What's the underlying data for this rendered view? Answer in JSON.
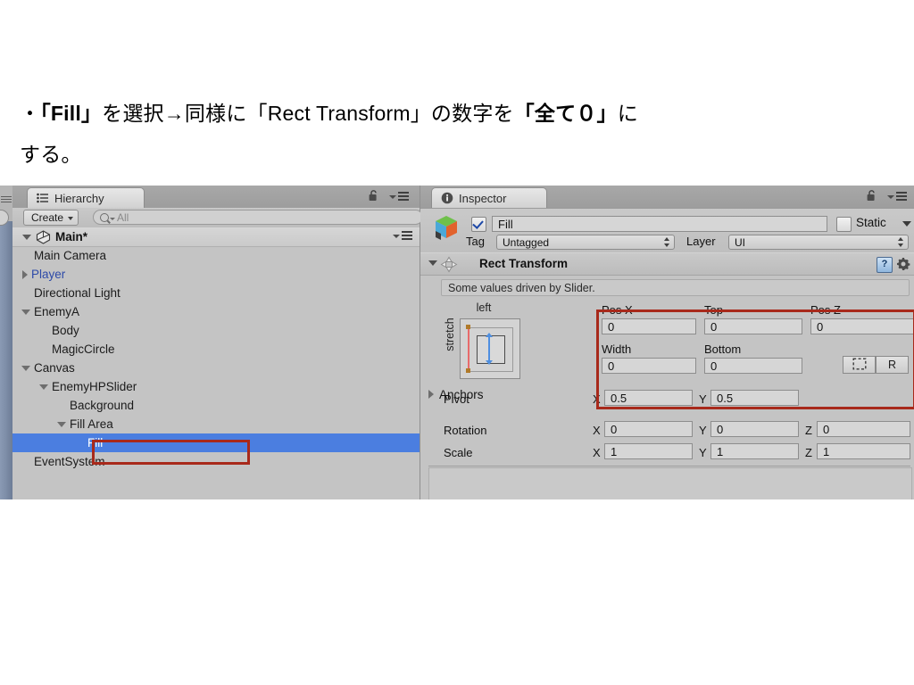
{
  "caption": {
    "line1_a": "・",
    "line1_b": "「Fill」",
    "line1_c": "を選択→同様に「Rect Transform」の数字を",
    "line1_d": "「全て０」",
    "line1_e": "に",
    "line2": "する。"
  },
  "hierarchy": {
    "tab_label": "Hierarchy",
    "create_button": "Create",
    "search_placeholder": "All",
    "scene_name": "Main*",
    "items": [
      {
        "label": "Main Camera",
        "depth": 1,
        "twirl": "none",
        "state": "normal"
      },
      {
        "label": "Player",
        "depth": 1,
        "twirl": "closed",
        "state": "prefab"
      },
      {
        "label": "Directional Light",
        "depth": 1,
        "twirl": "none",
        "state": "normal"
      },
      {
        "label": "EnemyA",
        "depth": 1,
        "twirl": "open",
        "state": "normal"
      },
      {
        "label": "Body",
        "depth": 2,
        "twirl": "none",
        "state": "normal"
      },
      {
        "label": "MagicCircle",
        "depth": 2,
        "twirl": "none",
        "state": "normal"
      },
      {
        "label": "Canvas",
        "depth": 1,
        "twirl": "open",
        "state": "normal"
      },
      {
        "label": "EnemyHPSlider",
        "depth": 2,
        "twirl": "open",
        "state": "normal"
      },
      {
        "label": "Background",
        "depth": 3,
        "twirl": "none",
        "state": "normal"
      },
      {
        "label": "Fill Area",
        "depth": 3,
        "twirl": "open",
        "state": "normal"
      },
      {
        "label": "Fill",
        "depth": 4,
        "twirl": "none",
        "state": "selected"
      },
      {
        "label": "EventSystem",
        "depth": 1,
        "twirl": "none",
        "state": "normal"
      }
    ]
  },
  "inspector": {
    "tab_label": "Inspector",
    "object_name": "Fill",
    "object_enabled": true,
    "static_label": "Static",
    "static_checked": false,
    "tag_label": "Tag",
    "tag_value": "Untagged",
    "layer_label": "Layer",
    "layer_value": "UI",
    "component": {
      "title": "Rect Transform",
      "help_glyph": "?",
      "driven_note": "Some values driven by Slider.",
      "anchor_preset": {
        "top_label": "left",
        "side_label": "stretch"
      },
      "anchors_foldout": "Anchors",
      "fields": [
        {
          "label": "Pos X",
          "value": "0"
        },
        {
          "label": "Top",
          "value": "0"
        },
        {
          "label": "Pos Z",
          "value": "0"
        },
        {
          "label": "Width",
          "value": "0"
        },
        {
          "label": "Bottom",
          "value": "0"
        }
      ],
      "blueprint_button": "",
      "raw_button": "R",
      "pivot": {
        "label": "Pivot",
        "x_axis": "X",
        "x": "0.5",
        "y_axis": "Y",
        "y": "0.5"
      },
      "rotation": {
        "label": "Rotation",
        "x_axis": "X",
        "x": "0",
        "y_axis": "Y",
        "y": "0",
        "z_axis": "Z",
        "z": "0"
      },
      "scale": {
        "label": "Scale",
        "x_axis": "X",
        "x": "1",
        "y_axis": "Y",
        "y": "1",
        "z_axis": "Z",
        "z": "1"
      }
    }
  },
  "colors": {
    "panel_bg": "#c4c4c4",
    "selection_blue": "#4b7ee0",
    "annotation_red": "#a8291b",
    "prefab_blue": "#2d4aa8"
  }
}
